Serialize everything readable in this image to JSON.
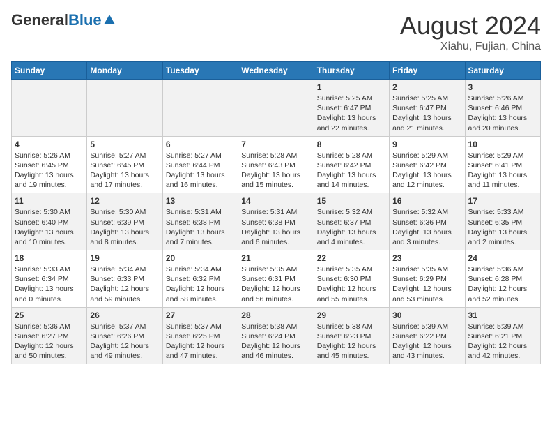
{
  "header": {
    "logo_general": "General",
    "logo_blue": "Blue",
    "title": "August 2024",
    "subtitle": "Xiahu, Fujian, China"
  },
  "days_of_week": [
    "Sunday",
    "Monday",
    "Tuesday",
    "Wednesday",
    "Thursday",
    "Friday",
    "Saturday"
  ],
  "weeks": [
    [
      {
        "day": "",
        "content": ""
      },
      {
        "day": "",
        "content": ""
      },
      {
        "day": "",
        "content": ""
      },
      {
        "day": "",
        "content": ""
      },
      {
        "day": "1",
        "content": "Sunrise: 5:25 AM\nSunset: 6:47 PM\nDaylight: 13 hours\nand 22 minutes."
      },
      {
        "day": "2",
        "content": "Sunrise: 5:25 AM\nSunset: 6:47 PM\nDaylight: 13 hours\nand 21 minutes."
      },
      {
        "day": "3",
        "content": "Sunrise: 5:26 AM\nSunset: 6:46 PM\nDaylight: 13 hours\nand 20 minutes."
      }
    ],
    [
      {
        "day": "4",
        "content": "Sunrise: 5:26 AM\nSunset: 6:45 PM\nDaylight: 13 hours\nand 19 minutes."
      },
      {
        "day": "5",
        "content": "Sunrise: 5:27 AM\nSunset: 6:45 PM\nDaylight: 13 hours\nand 17 minutes."
      },
      {
        "day": "6",
        "content": "Sunrise: 5:27 AM\nSunset: 6:44 PM\nDaylight: 13 hours\nand 16 minutes."
      },
      {
        "day": "7",
        "content": "Sunrise: 5:28 AM\nSunset: 6:43 PM\nDaylight: 13 hours\nand 15 minutes."
      },
      {
        "day": "8",
        "content": "Sunrise: 5:28 AM\nSunset: 6:42 PM\nDaylight: 13 hours\nand 14 minutes."
      },
      {
        "day": "9",
        "content": "Sunrise: 5:29 AM\nSunset: 6:42 PM\nDaylight: 13 hours\nand 12 minutes."
      },
      {
        "day": "10",
        "content": "Sunrise: 5:29 AM\nSunset: 6:41 PM\nDaylight: 13 hours\nand 11 minutes."
      }
    ],
    [
      {
        "day": "11",
        "content": "Sunrise: 5:30 AM\nSunset: 6:40 PM\nDaylight: 13 hours\nand 10 minutes."
      },
      {
        "day": "12",
        "content": "Sunrise: 5:30 AM\nSunset: 6:39 PM\nDaylight: 13 hours\nand 8 minutes."
      },
      {
        "day": "13",
        "content": "Sunrise: 5:31 AM\nSunset: 6:38 PM\nDaylight: 13 hours\nand 7 minutes."
      },
      {
        "day": "14",
        "content": "Sunrise: 5:31 AM\nSunset: 6:38 PM\nDaylight: 13 hours\nand 6 minutes."
      },
      {
        "day": "15",
        "content": "Sunrise: 5:32 AM\nSunset: 6:37 PM\nDaylight: 13 hours\nand 4 minutes."
      },
      {
        "day": "16",
        "content": "Sunrise: 5:32 AM\nSunset: 6:36 PM\nDaylight: 13 hours\nand 3 minutes."
      },
      {
        "day": "17",
        "content": "Sunrise: 5:33 AM\nSunset: 6:35 PM\nDaylight: 13 hours\nand 2 minutes."
      }
    ],
    [
      {
        "day": "18",
        "content": "Sunrise: 5:33 AM\nSunset: 6:34 PM\nDaylight: 13 hours\nand 0 minutes."
      },
      {
        "day": "19",
        "content": "Sunrise: 5:34 AM\nSunset: 6:33 PM\nDaylight: 12 hours\nand 59 minutes."
      },
      {
        "day": "20",
        "content": "Sunrise: 5:34 AM\nSunset: 6:32 PM\nDaylight: 12 hours\nand 58 minutes."
      },
      {
        "day": "21",
        "content": "Sunrise: 5:35 AM\nSunset: 6:31 PM\nDaylight: 12 hours\nand 56 minutes."
      },
      {
        "day": "22",
        "content": "Sunrise: 5:35 AM\nSunset: 6:30 PM\nDaylight: 12 hours\nand 55 minutes."
      },
      {
        "day": "23",
        "content": "Sunrise: 5:35 AM\nSunset: 6:29 PM\nDaylight: 12 hours\nand 53 minutes."
      },
      {
        "day": "24",
        "content": "Sunrise: 5:36 AM\nSunset: 6:28 PM\nDaylight: 12 hours\nand 52 minutes."
      }
    ],
    [
      {
        "day": "25",
        "content": "Sunrise: 5:36 AM\nSunset: 6:27 PM\nDaylight: 12 hours\nand 50 minutes."
      },
      {
        "day": "26",
        "content": "Sunrise: 5:37 AM\nSunset: 6:26 PM\nDaylight: 12 hours\nand 49 minutes."
      },
      {
        "day": "27",
        "content": "Sunrise: 5:37 AM\nSunset: 6:25 PM\nDaylight: 12 hours\nand 47 minutes."
      },
      {
        "day": "28",
        "content": "Sunrise: 5:38 AM\nSunset: 6:24 PM\nDaylight: 12 hours\nand 46 minutes."
      },
      {
        "day": "29",
        "content": "Sunrise: 5:38 AM\nSunset: 6:23 PM\nDaylight: 12 hours\nand 45 minutes."
      },
      {
        "day": "30",
        "content": "Sunrise: 5:39 AM\nSunset: 6:22 PM\nDaylight: 12 hours\nand 43 minutes."
      },
      {
        "day": "31",
        "content": "Sunrise: 5:39 AM\nSunset: 6:21 PM\nDaylight: 12 hours\nand 42 minutes."
      }
    ]
  ]
}
